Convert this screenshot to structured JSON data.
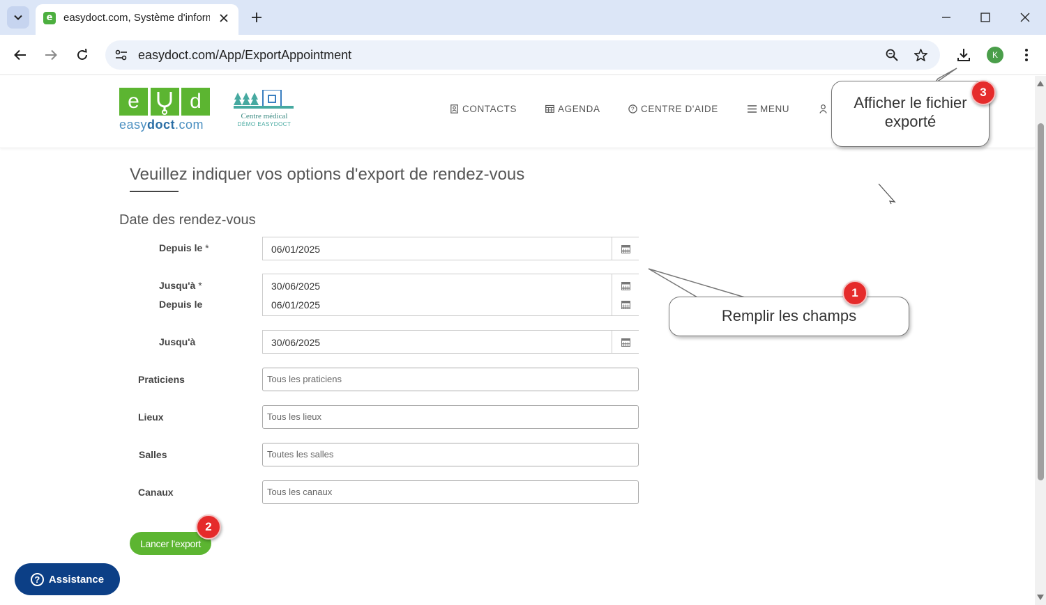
{
  "browser": {
    "tab_title": "easydoct.com, Système d'information",
    "favicon_letter": "e",
    "url": "easydoct.com/App/ExportAppointment",
    "profile_initial": "K"
  },
  "site": {
    "logo": {
      "e": "e",
      "d": "d",
      "name_light_1": "easy",
      "name_bold": "doct",
      "name_light_2": ".com"
    },
    "centre_logo": {
      "title": "Centre médical",
      "subtitle": "DÉMO EASYDOCT"
    },
    "nav": {
      "contacts": "CONTACTS",
      "agenda": "AGENDA",
      "help": "CENTRE D'AIDE",
      "menu": "MENU"
    }
  },
  "form": {
    "page_title": "Veuillez indiquer vos options d'export de rendez-vous",
    "section_title": "Date des rendez-vous",
    "required_marker": "*",
    "from_label": "Depuis le",
    "to_label": "Jusqu'à",
    "from_value": "06/01/2025",
    "to_value": "30/06/2025",
    "practitioners_label": "Praticiens",
    "practitioners_placeholder": "Tous les praticiens",
    "places_label": "Lieux",
    "places_placeholder": "Tous les lieux",
    "rooms_label": "Salles",
    "rooms_placeholder": "Toutes les salles",
    "channels_label": "Canaux",
    "channels_placeholder": "Tous les canaux",
    "export_button": "Lancer l'export",
    "assistance_button": "Assistance"
  },
  "annotations": {
    "callout_1": "Remplir les champs",
    "callout_3_line1": "Afficher le fichier",
    "callout_3_line2": "exporté",
    "badge_1": "1",
    "badge_2": "2",
    "badge_3": "3",
    "badge_color": "#e52b2b"
  },
  "colors": {
    "brand_green": "#5cb531",
    "assist_blue": "#0c3f86",
    "logo_blue": "#4a8fc1"
  }
}
